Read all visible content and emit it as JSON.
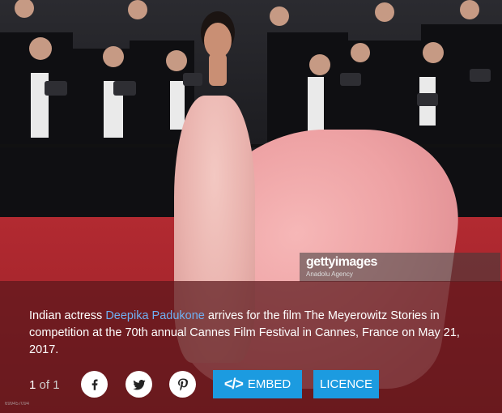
{
  "watermark": {
    "logo_text": "gettyimages",
    "credit": "Anadolu Agency"
  },
  "caption": {
    "prefix": "Indian actress ",
    "link_text": "Deepika Padukone",
    "suffix": " arrives for the film The Meyerowitz Stories in competition at the 70th annual Cannes Film Festival in Cannes, France on May 21, 2017."
  },
  "pager": {
    "current": "1",
    "separator": " of ",
    "total": "1"
  },
  "share": {
    "icons": [
      "facebook-icon",
      "twitter-icon",
      "pinterest-icon"
    ]
  },
  "actions": {
    "embed_icon": "</>",
    "embed_label": "EMBED",
    "licence_label": "LICENCE"
  },
  "asset_id": "699457094",
  "colors": {
    "link": "#6fb0f2",
    "button": "#1c9be0",
    "caption_bg": "#5c181c"
  }
}
